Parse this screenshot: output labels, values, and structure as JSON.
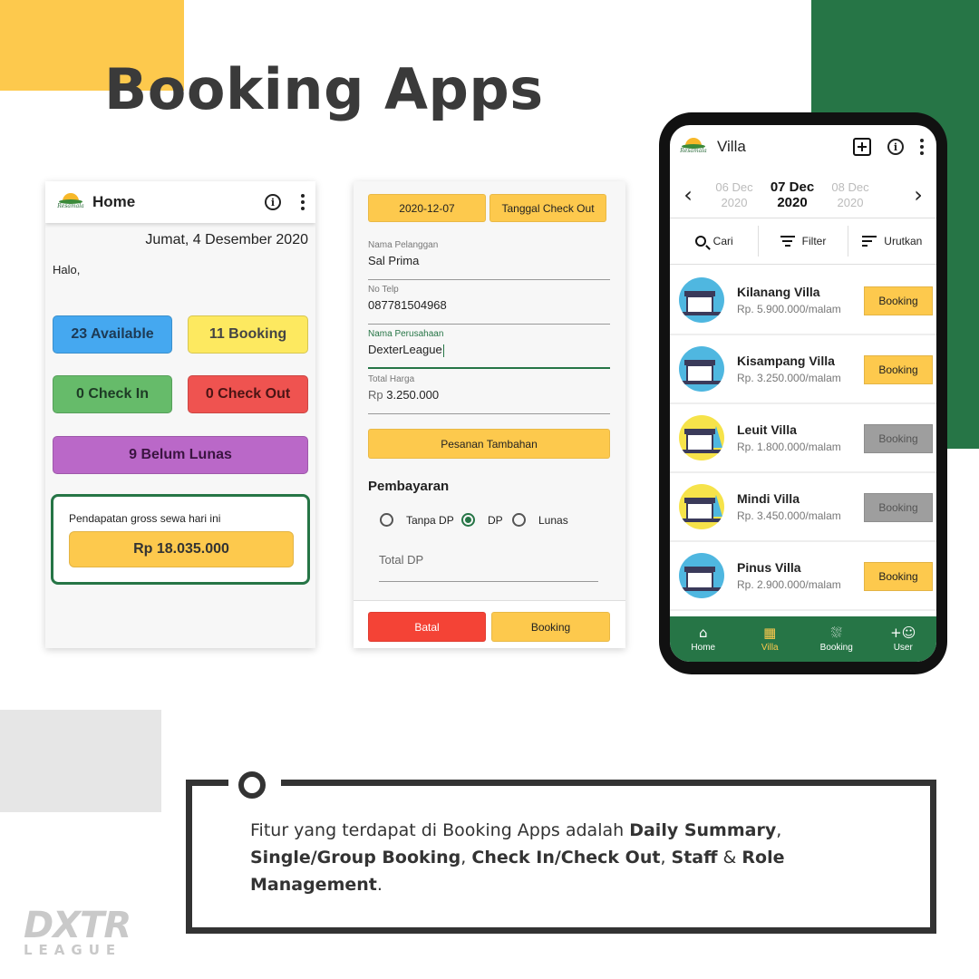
{
  "headline": "Booking Apps",
  "screen_home": {
    "title": "Home",
    "logo_text": "Resamala",
    "date": "Jumat, 4 Desember 2020",
    "greeting": "Halo,",
    "tiles": {
      "available": "23 Available",
      "booking": "11 Booking",
      "check_in": "0 Check In",
      "check_out": "0 Check Out",
      "unpaid": "9 Belum Lunas"
    },
    "income_label": "Pendapatan gross sewa hari ini",
    "income_value": "Rp 18.035.000"
  },
  "screen_form": {
    "checkin_date": "2020-12-07",
    "checkout_placeholder": "Tanggal Check Out",
    "customer_label": "Nama Pelanggan",
    "customer_value": "Sal Prima",
    "phone_label": "No Telp",
    "phone_value": "087781504968",
    "company_label": "Nama Perusahaan",
    "company_value": "DexterLeague",
    "total_label": "Total Harga",
    "total_prefix": "Rp",
    "total_value": "3.250.000",
    "extra_order_button": "Pesanan Tambahan",
    "payment_title": "Pembayaran",
    "payment_options": [
      "Tanpa DP",
      "DP",
      "Lunas"
    ],
    "payment_selected": "DP",
    "dp_placeholder": "Total DP",
    "cancel_button": "Batal",
    "booking_button": "Booking"
  },
  "screen_villa": {
    "title": "Villa",
    "logo_text": "Resamala",
    "dates": {
      "prev_day": "06 Dec",
      "prev_year": "2020",
      "current_day": "07 Dec",
      "current_year": "2020",
      "next_day": "08 Dec",
      "next_year": "2020"
    },
    "search_label": "Cari",
    "filter_label": "Filter",
    "sort_label": "Urutkan",
    "villas": [
      {
        "name": "Kilanang Villa",
        "price": "Rp. 5.900.000/malam",
        "button": "Booking",
        "available": true,
        "icon_bg": "#4fb7e0"
      },
      {
        "name": "Kisampang Villa",
        "price": "Rp. 3.250.000/malam",
        "button": "Booking",
        "available": true,
        "icon_bg": "#4fb7e0"
      },
      {
        "name": "Leuit Villa",
        "price": "Rp. 1.800.000/malam",
        "button": "Booking",
        "available": false,
        "icon_bg": "#f6e34a"
      },
      {
        "name": "Mindi Villa",
        "price": "Rp. 3.450.000/malam",
        "button": "Booking",
        "available": false,
        "icon_bg": "#f6e34a"
      },
      {
        "name": "Pinus Villa",
        "price": "Rp. 2.900.000/malam",
        "button": "Booking",
        "available": true,
        "icon_bg": "#4fb7e0"
      }
    ],
    "nav": [
      {
        "label": "Home",
        "icon": "home-icon",
        "active": false
      },
      {
        "label": "Villa",
        "icon": "building-icon",
        "active": true
      },
      {
        "label": "Booking",
        "icon": "bed-icon",
        "active": false
      },
      {
        "label": "User",
        "icon": "add-user-icon",
        "active": false
      }
    ]
  },
  "caption": {
    "intro": "Fitur yang terdapat di Booking Apps adalah ",
    "f1": "Daily Summary",
    "s1": ", ",
    "f2": "Single/Group Booking",
    "s2": ", ",
    "f3": "Check In/Check Out",
    "s3": ", ",
    "f4": "Staff",
    "s4": " & ",
    "f5": "Role Management",
    "end": "."
  },
  "brand": {
    "top": "DXTR",
    "bottom": "LEAGUE"
  },
  "colors": {
    "yellow": "#fdc94d",
    "green": "#267546",
    "blue": "#45a8f0",
    "red": "#ef5350",
    "check_in_green": "#66bb6a",
    "purple": "#ba68c8",
    "light_yellow": "#fde960",
    "gray_button": "#9e9e9e",
    "cancel_red": "#f44336"
  }
}
